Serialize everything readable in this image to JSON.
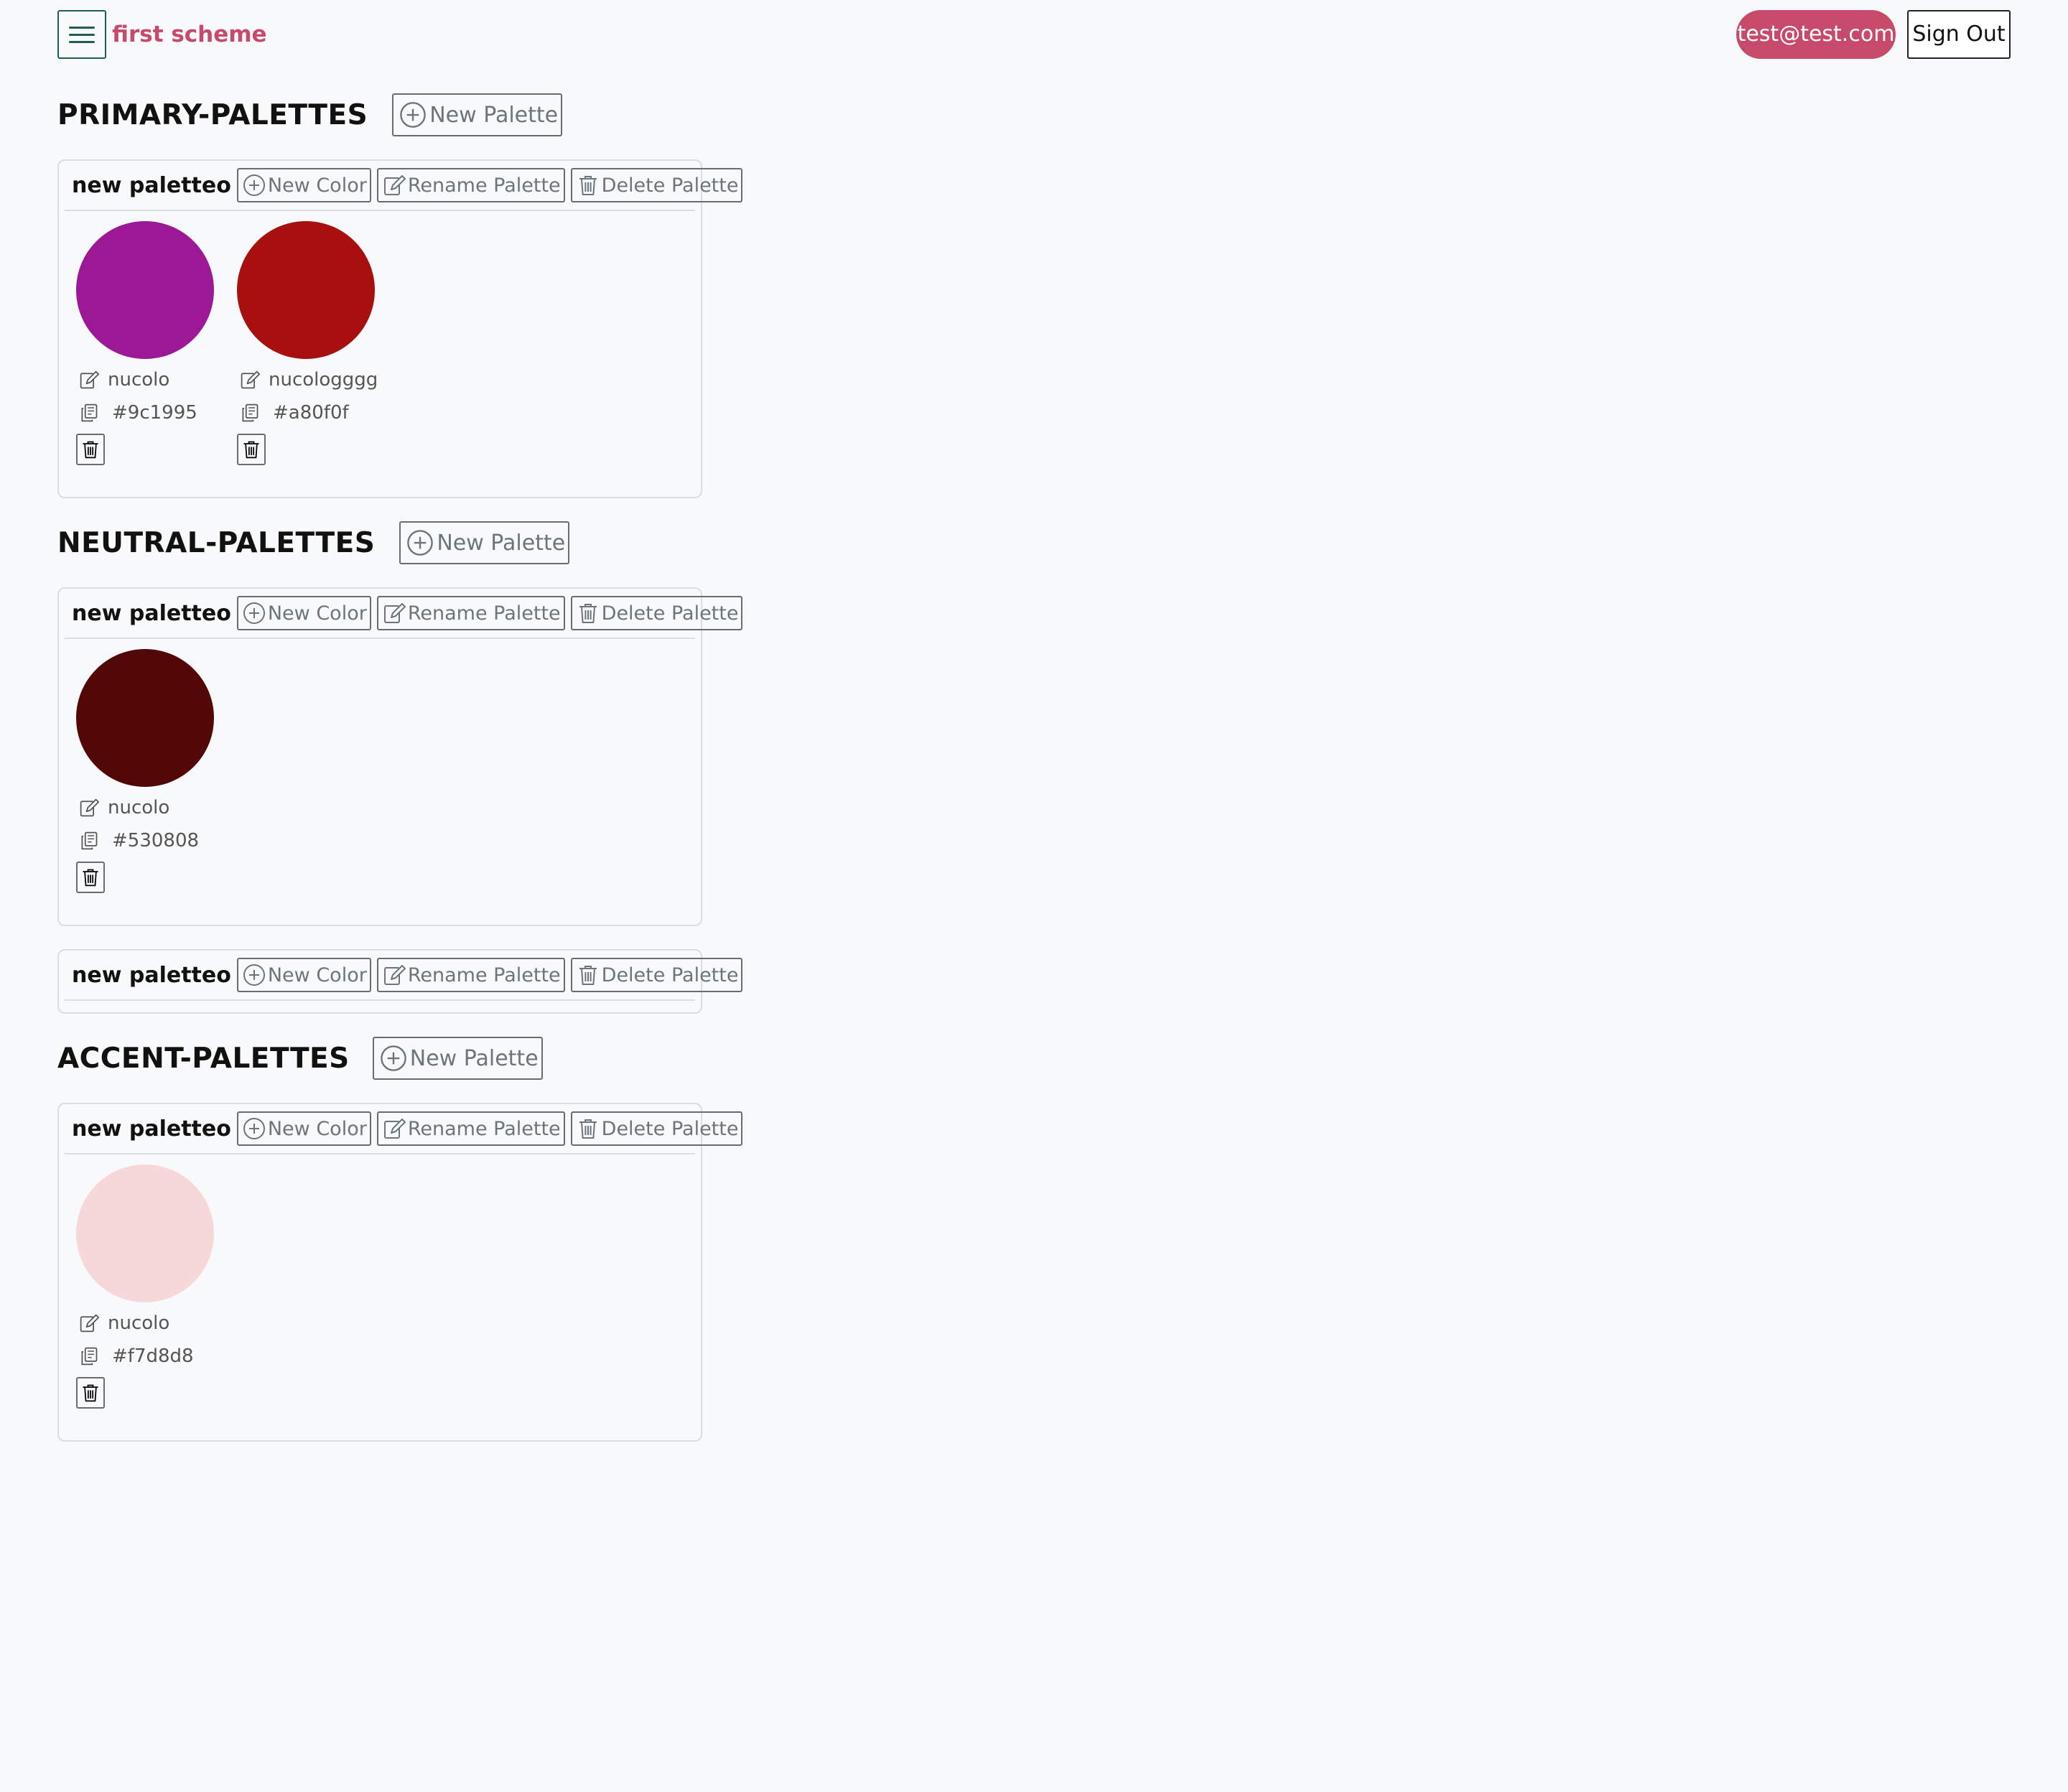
{
  "header": {
    "scheme_title": "first scheme",
    "user_email": "test@test.com",
    "sign_out_label": "Sign Out"
  },
  "sections": [
    {
      "title": "PRIMARY-PALETTES",
      "new_palette_label": "New Palette",
      "palettes": [
        {
          "name": "new paletteo",
          "colors": [
            {
              "name": "nucolo",
              "hex": "#9c1995"
            },
            {
              "name": "nucologggg",
              "hex": "#a80f0f"
            }
          ]
        }
      ]
    },
    {
      "title": "NEUTRAL-PALETTES",
      "new_palette_label": "New Palette",
      "palettes": [
        {
          "name": "new paletteo",
          "colors": [
            {
              "name": "nucolo",
              "hex": "#530808"
            }
          ]
        },
        {
          "name": "new paletteo",
          "colors": []
        }
      ]
    },
    {
      "title": "ACCENT-PALETTES",
      "new_palette_label": "New Palette",
      "palettes": [
        {
          "name": "new paletteo",
          "colors": [
            {
              "name": "nucolo",
              "hex": "#f7d8d8"
            }
          ]
        }
      ]
    }
  ],
  "palette_actions": {
    "new_color_label": "New Color",
    "rename_palette_label": "Rename Palette",
    "delete_palette_label": "Delete Palette"
  },
  "theme": {
    "accent": "#c74a6a",
    "menu_border": "#1e5e55",
    "background": "#f8f9fb"
  }
}
